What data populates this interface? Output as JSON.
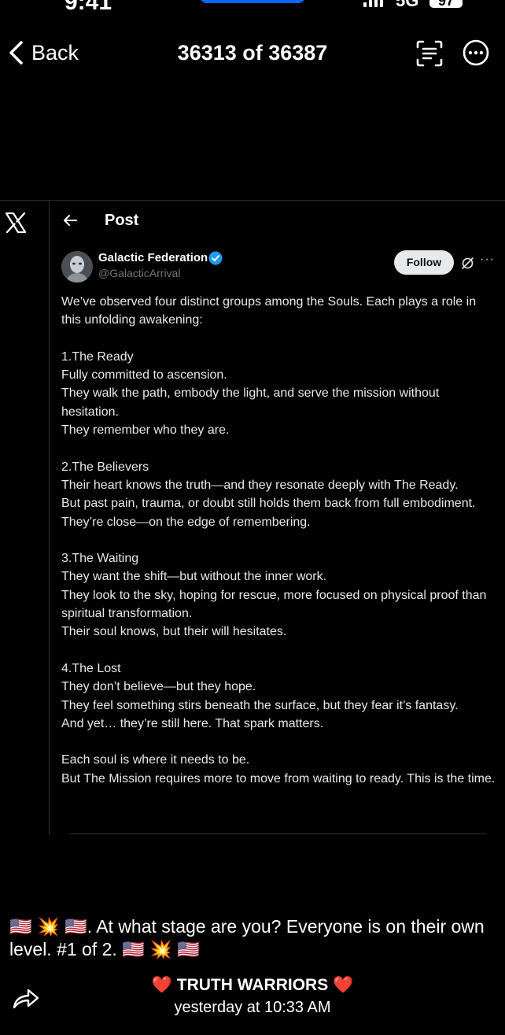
{
  "status_bar": {
    "time": "9:41",
    "network": "5G",
    "battery": "97"
  },
  "nav": {
    "back_label": "Back",
    "title": "36313 of 36387",
    "scan_icon": "text-scan-icon",
    "more_icon": "more-circle-icon"
  },
  "post": {
    "header_title": "Post",
    "author_name": "Galactic Federation",
    "author_handle": "@GalacticArrival",
    "follow_label": "Follow",
    "more": "···",
    "body": [
      "We’ve observed four distinct groups among the Souls. Each plays a role in this unfolding awakening:",
      "",
      "1.The Ready",
      "Fully committed to ascension.",
      "They walk the path, embody the light, and serve the mission without hesitation.",
      "They remember who they are.",
      "",
      "2.The Believers",
      "Their heart knows the truth—and they resonate deeply with The Ready.",
      "But past pain, trauma, or doubt still holds them back from full embodiment.",
      "They’re close—on the edge of remembering.",
      "",
      "3.The Waiting",
      "They want the shift—but without the inner work.",
      "They look to the sky, hoping for rescue, more focused on physical proof than spiritual transformation.",
      "Their soul knows, but their will hesitates.",
      "",
      "4.The Lost",
      "They don’t believe—but they hope.",
      "They feel something stirs beneath the surface, but they fear it’s fantasy.",
      "And yet… they’re still here. That spark matters.",
      "",
      "Each soul is where it needs to be.",
      "But The Mission requires more to move from waiting to ready. This is the time."
    ]
  },
  "caption": "🇺🇸 💥 🇺🇸. At what stage are you?  Everyone is on their own level.  #1 of 2. 🇺🇸 💥 🇺🇸",
  "sender": "❤️ TRUTH WARRIORS ❤️",
  "timestamp": "yesterday at 10:33 AM",
  "colors": {
    "background": "#000000",
    "verified": "#1d9bf0",
    "handle": "#71767b",
    "follow_bg": "#e7e9ea"
  }
}
